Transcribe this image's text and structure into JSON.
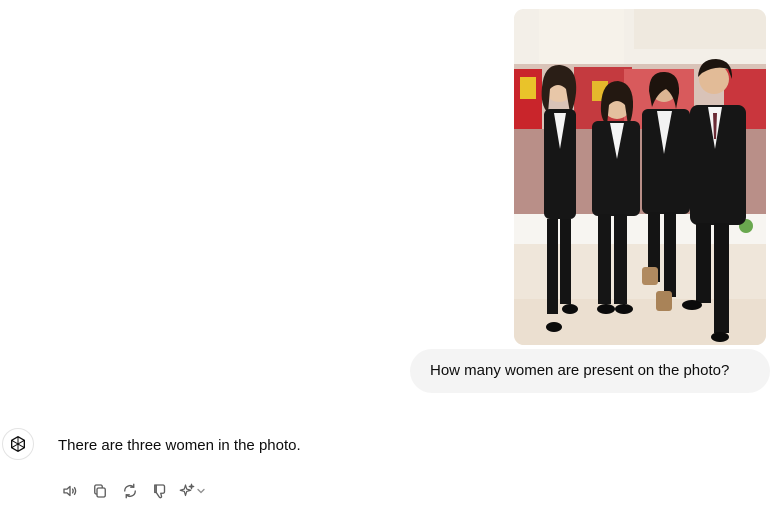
{
  "conversation": {
    "user_message": {
      "text": "How many women are present on the photo?",
      "image": "group-photo-four-people-in-black-suits"
    },
    "assistant_message": {
      "text": "There are three women in the photo."
    }
  },
  "actions": [
    {
      "name": "read-aloud",
      "icon": "speaker-icon"
    },
    {
      "name": "copy",
      "icon": "copy-icon"
    },
    {
      "name": "regenerate",
      "icon": "refresh-icon"
    },
    {
      "name": "bad-response",
      "icon": "thumbs-down-icon"
    },
    {
      "name": "change-model",
      "icon": "sparkle-icon"
    }
  ],
  "colors": {
    "bubble": "#f4f4f4",
    "text": "#0d0d0d",
    "icon": "#5d5d5d"
  }
}
